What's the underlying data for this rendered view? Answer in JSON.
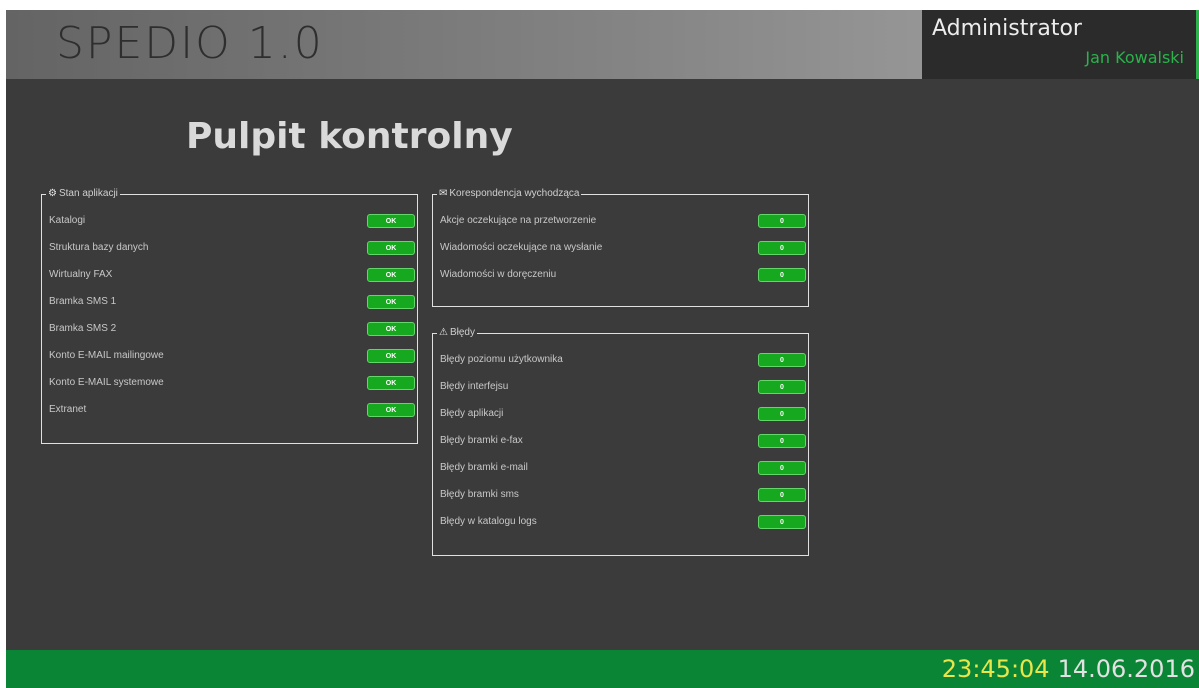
{
  "app": {
    "title": "SPEDIO 1.0"
  },
  "user": {
    "role": "Administrator",
    "name": "Jan Kowalski"
  },
  "page": {
    "title": "Pulpit kontrolny"
  },
  "panels": {
    "stan": {
      "icon": "gear-icon",
      "legend": "Stan aplikacji",
      "rows": [
        {
          "label": "Katalogi",
          "value": "OK"
        },
        {
          "label": "Struktura bazy danych",
          "value": "OK"
        },
        {
          "label": "Wirtualny FAX",
          "value": "OK"
        },
        {
          "label": "Bramka SMS 1",
          "value": "OK"
        },
        {
          "label": "Bramka SMS 2",
          "value": "OK"
        },
        {
          "label": "Konto E-MAIL mailingowe",
          "value": "OK"
        },
        {
          "label": "Konto E-MAIL systemowe",
          "value": "OK"
        },
        {
          "label": "Extranet",
          "value": "OK"
        }
      ]
    },
    "korespondencja": {
      "icon": "envelope-icon",
      "legend": "Korespondencja wychodząca",
      "rows": [
        {
          "label": "Akcje oczekujące na przetworzenie",
          "value": "0"
        },
        {
          "label": "Wiadomości oczekujące na wysłanie",
          "value": "0"
        },
        {
          "label": "Wiadomości w doręczeniu",
          "value": "0"
        }
      ]
    },
    "bledy": {
      "icon": "warning-icon",
      "legend": "Błędy",
      "rows": [
        {
          "label": "Błędy poziomu użytkownika",
          "value": "0"
        },
        {
          "label": "Błędy interfejsu",
          "value": "0"
        },
        {
          "label": "Błędy aplikacji",
          "value": "0"
        },
        {
          "label": "Błędy bramki e-fax",
          "value": "0"
        },
        {
          "label": "Błędy bramki e-mail",
          "value": "0"
        },
        {
          "label": "Błędy bramki sms",
          "value": "0"
        },
        {
          "label": "Błędy w katalogu logs",
          "value": "0"
        }
      ]
    }
  },
  "footer": {
    "time": "23:45:04",
    "date": "14.06.2016"
  },
  "colors": {
    "background": "#3b3b3b",
    "footer": "#0a8535",
    "badge": "#16a81f",
    "username": "#29b34a",
    "time": "#e9e64b"
  }
}
